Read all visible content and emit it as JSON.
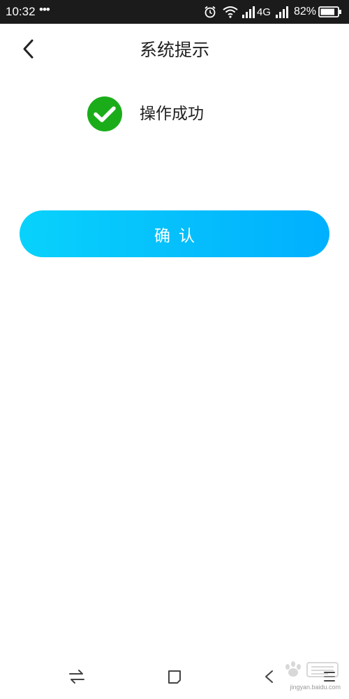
{
  "status_bar": {
    "time": "10:32",
    "more": "•••",
    "network": "4G",
    "battery": "82%"
  },
  "header": {
    "back_icon": "chevron-left-icon",
    "title": "系统提示"
  },
  "message": {
    "icon": "check-circle-icon",
    "icon_color": "#1aad19",
    "text": "操作成功"
  },
  "confirm": {
    "label": "确认",
    "gradient_start": "#08d2fc",
    "gradient_end": "#00b0ff"
  },
  "nav_bar": {
    "icons": [
      "switch-arrows-icon",
      "home-square-icon",
      "back-icon",
      "menu-icon"
    ]
  },
  "watermark": {
    "text": "jingyan.baidu.com"
  }
}
